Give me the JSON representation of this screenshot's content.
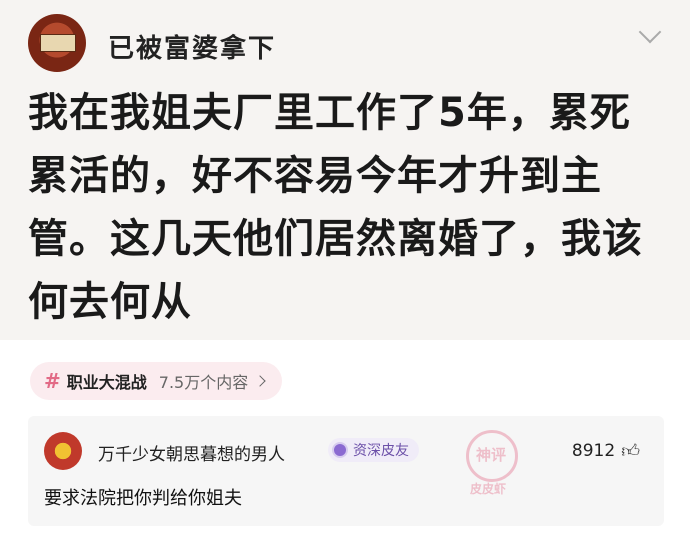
{
  "post": {
    "author": "已被富婆拿下",
    "lines": [
      "我在我姐夫厂里工作了5年，累死",
      "累活的，好不容易今年才升到主",
      "管。这几天他们居然离婚了，我该",
      "何去何从"
    ]
  },
  "topic": {
    "hash": "#",
    "name": "职业大混战",
    "count": "7.5万个内容"
  },
  "comment": {
    "username": "万千少女朝思暮想的男人",
    "badge": "资深皮友",
    "likes": "8912",
    "text": "要求法院把你判给你姐夫"
  },
  "watermark": {
    "line1": "神评",
    "line2": "皮皮虾"
  },
  "icons": {
    "more": "chevron-down-icon",
    "like": "thumbs-up-icon",
    "topic_arrow": "chevron-right-icon",
    "badge": "medal-icon"
  },
  "colors": {
    "topic_bg": "#fbecef",
    "topic_hash": "#e26a86",
    "badge_text": "#6b4fa8",
    "watermark": "#e05a7a"
  }
}
